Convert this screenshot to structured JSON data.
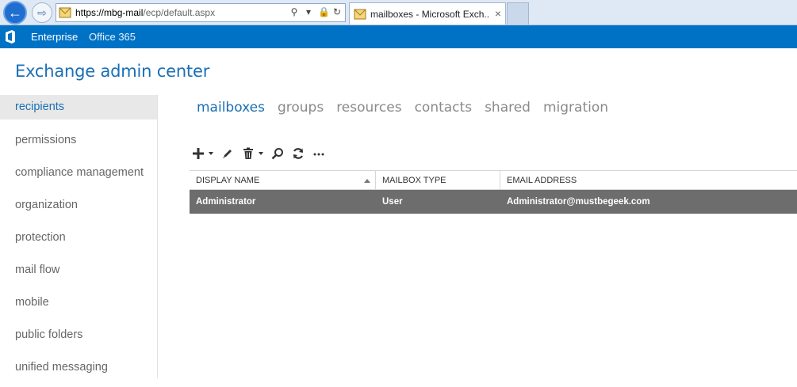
{
  "browser": {
    "url_host": "https://mbg-mail",
    "url_path": "/ecp/default.aspx",
    "tab_title": "mailboxes - Microsoft Exch...",
    "tab_close": "×",
    "addr_icons": [
      "search-icon",
      "dropdown-icon",
      "lock-icon",
      "refresh-icon"
    ]
  },
  "topbar": {
    "links": [
      "Enterprise",
      "Office 365"
    ],
    "accent": "#0072c6"
  },
  "app": {
    "title": "Exchange admin center"
  },
  "leftnav": {
    "items": [
      "recipients",
      "permissions",
      "compliance management",
      "organization",
      "protection",
      "mail flow",
      "mobile",
      "public folders",
      "unified messaging"
    ],
    "selected": "recipients"
  },
  "subtabs": {
    "items": [
      "mailboxes",
      "groups",
      "resources",
      "contacts",
      "shared",
      "migration"
    ],
    "active": "mailboxes"
  },
  "toolbar": {
    "icons": [
      "add-icon",
      "edit-icon",
      "delete-icon",
      "search-icon",
      "refresh-icon",
      "more-icon"
    ]
  },
  "grid": {
    "columns": [
      "DISPLAY NAME",
      "MAILBOX TYPE",
      "EMAIL ADDRESS"
    ],
    "sort_column": "DISPLAY NAME",
    "sort_direction": "ascending",
    "rows": [
      {
        "display_name": "Administrator",
        "mailbox_type": "User",
        "email": "Administrator@mustbegeek.com",
        "selected": true
      }
    ]
  },
  "colors": {
    "title_blue": "#1a6fb5",
    "selected_row": "#6d6d6d"
  }
}
